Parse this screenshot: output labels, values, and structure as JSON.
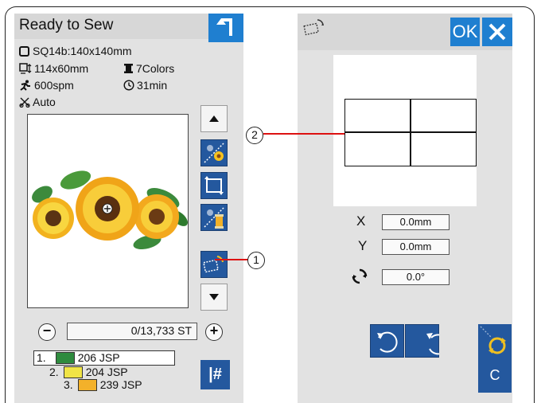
{
  "left": {
    "title": "Ready to Sew",
    "hoop": "SQ14b:140x140mm",
    "size": "114x60mm",
    "colors": "7Colors",
    "speed": "600spm",
    "time": "31min",
    "thread_cut": "Auto",
    "stitch_counter": "0/13,733 ST",
    "minus_label": "−",
    "plus_label": "+",
    "thread_list": [
      {
        "num": "1.",
        "code": "206 JSP",
        "color": "#2e8b3e"
      },
      {
        "num": "2.",
        "code": "204 JSP",
        "color": "#f0e446"
      },
      {
        "num": "3.",
        "code": "239 JSP",
        "color": "#f3b12a"
      }
    ],
    "hash_label": "|#"
  },
  "right": {
    "ok_label": "OK",
    "x_label": "X",
    "x_value": "0.0mm",
    "y_label": "Y",
    "y_value": "0.0mm",
    "angle_value": "0.0°",
    "c_label": "C"
  },
  "callouts": {
    "one": "1",
    "two": "2"
  },
  "icons": [
    "back-arrow-icon",
    "hoop-icon",
    "size-icon",
    "spool-icon",
    "runner-icon",
    "clock-icon",
    "scissors-icon",
    "arrow-up-icon",
    "arrow-down-icon",
    "color-icon",
    "flip-icon",
    "monochrome-icon",
    "baste-layout-icon",
    "close-icon",
    "rotate-left-icon",
    "rotate-right-icon",
    "rotate-reset-icon"
  ],
  "colors": {
    "header_blue": "#1f7fd0",
    "button_navy": "#24589e",
    "panel_gray": "#e2e2e2",
    "callout_red": "#dd1111"
  }
}
